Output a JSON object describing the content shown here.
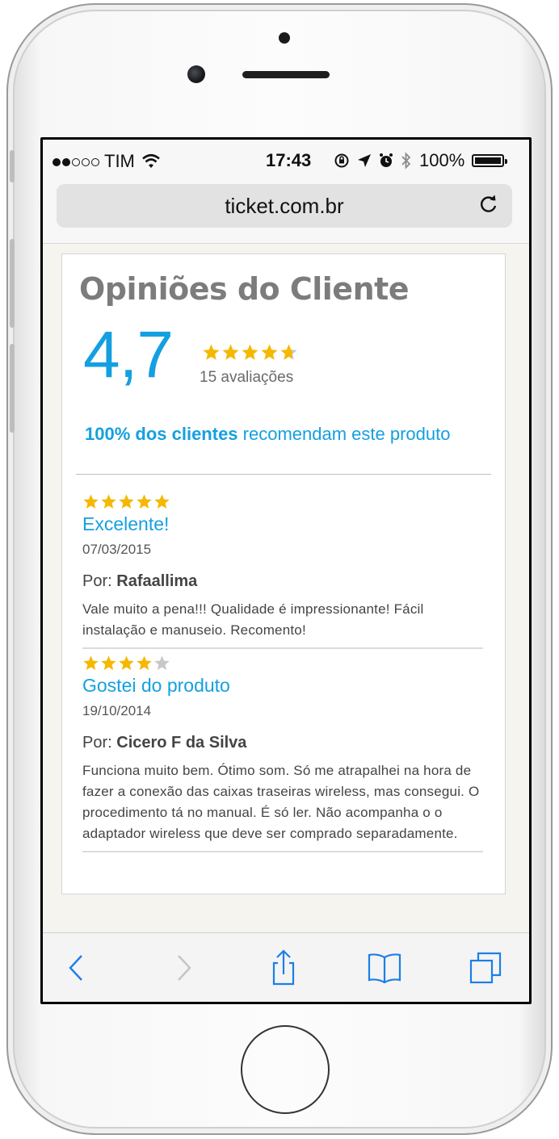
{
  "status_bar": {
    "carrier": "TIM",
    "time": "17:43",
    "battery": "100%"
  },
  "browser": {
    "url": "ticket.com.br"
  },
  "reviews_section": {
    "title": "Opiniões do Cliente",
    "average": "4,7",
    "average_stars": 4.7,
    "count_label": "15 avaliações",
    "recommend_bold": "100% dos clientes",
    "recommend_rest": " recomendam este produto"
  },
  "reviews": [
    {
      "stars": 5,
      "title": "Excelente!",
      "date": "07/03/2015",
      "by_label": "Por: ",
      "author": "Rafaallima",
      "body": "Vale muito a pena!!! Qualidade é impressionante! Fácil instalação e manuseio. Recomento!"
    },
    {
      "stars": 4,
      "title": "Gostei do produto",
      "date": "19/10/2014",
      "by_label": "Por: ",
      "author": "Cicero F da Silva",
      "body": "Funciona muito bem. Ótimo som. Só me atrapalhei na hora de fazer a conexão das caixas traseiras wireless, mas consegui. O procedimento tá no manual. É só ler. Não acompanha o o adaptador wireless que deve ser comprado separadamente."
    }
  ],
  "colors": {
    "accent": "#14a0e0",
    "star_filled": "#f5b800",
    "star_empty": "#c8c8c8"
  },
  "icons": {
    "toolbar": [
      "back-icon",
      "forward-icon",
      "share-icon",
      "bookmarks-icon",
      "tabs-icon"
    ]
  }
}
